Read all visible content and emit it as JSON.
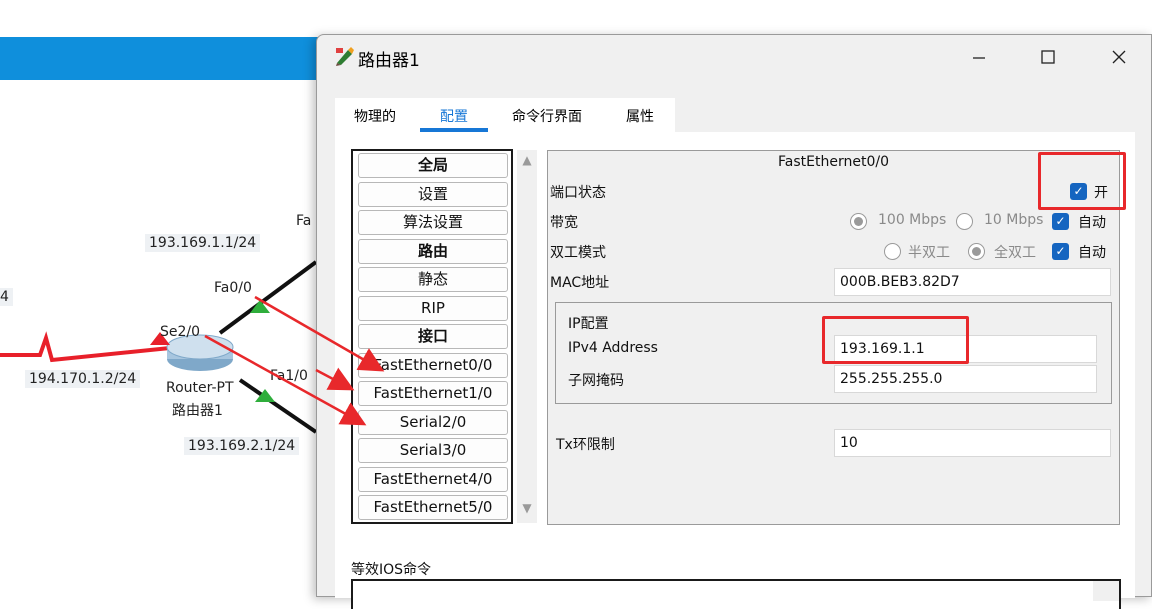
{
  "topology": {
    "labels": {
      "partial_left": "4",
      "ip_fa00": "193.169.1.1/24",
      "fa_partial": "Fa",
      "fa00": "Fa0/0",
      "se20": "Se2/0",
      "serial_ip": "194.170.1.2/24",
      "fa10": "Fa1/0",
      "router_model": "Router-PT",
      "router_name": "路由器1",
      "ip_fa10": "193.169.2.1/24"
    },
    "colors": {
      "top_bar": "#0f8fdc",
      "serial_link": "#e8202a",
      "link_up": "#2fae3c",
      "annotation_arrow": "#e8282b"
    }
  },
  "window": {
    "title": "路由器1",
    "icon": "router-pencil-icon",
    "minimize_icon": "minimize-icon",
    "maximize_icon": "maximize-icon",
    "close_icon": "close-icon"
  },
  "tabs": [
    {
      "label": "物理的",
      "active": false
    },
    {
      "label": "配置",
      "active": true
    },
    {
      "label": "命令行界面",
      "active": false
    },
    {
      "label": "属性",
      "active": false
    }
  ],
  "sidebar": {
    "items": [
      {
        "label": "全局",
        "header": true
      },
      {
        "label": "设置",
        "header": false
      },
      {
        "label": "算法设置",
        "header": false
      },
      {
        "label": "路由",
        "header": true
      },
      {
        "label": "静态",
        "header": false
      },
      {
        "label": "RIP",
        "header": false
      },
      {
        "label": "接口",
        "header": true
      },
      {
        "label": "FastEthernet0/0",
        "header": false
      },
      {
        "label": "FastEthernet1/0",
        "header": false
      },
      {
        "label": "Serial2/0",
        "header": false
      },
      {
        "label": "Serial3/0",
        "header": false
      },
      {
        "label": "FastEthernet4/0",
        "header": false
      },
      {
        "label": "FastEthernet5/0",
        "header": false
      }
    ]
  },
  "config": {
    "header": "FastEthernet0/0",
    "port_status": {
      "label": "端口状态",
      "checkbox_label": "开",
      "checked": true
    },
    "bandwidth": {
      "label": "带宽",
      "option1": "100 Mbps",
      "option2": "10 Mbps",
      "auto_label": "自动",
      "selected": "100 Mbps",
      "auto": true
    },
    "duplex": {
      "label": "双工模式",
      "option1": "半双工",
      "option2": "全双工",
      "auto_label": "自动",
      "selected": "全双工",
      "auto": true
    },
    "mac": {
      "label": "MAC地址",
      "value": "000B.BEB3.82D7"
    },
    "ip_group": {
      "label": "IP配置",
      "ipv4_label": "IPv4 Address",
      "ipv4_value": "193.169.1.1",
      "mask_label": "子网掩码",
      "mask_value": "255.255.255.0"
    },
    "tx_ring": {
      "label": "Tx环限制",
      "value": "10"
    }
  },
  "ios": {
    "label": "等效IOS命令",
    "value": ""
  }
}
